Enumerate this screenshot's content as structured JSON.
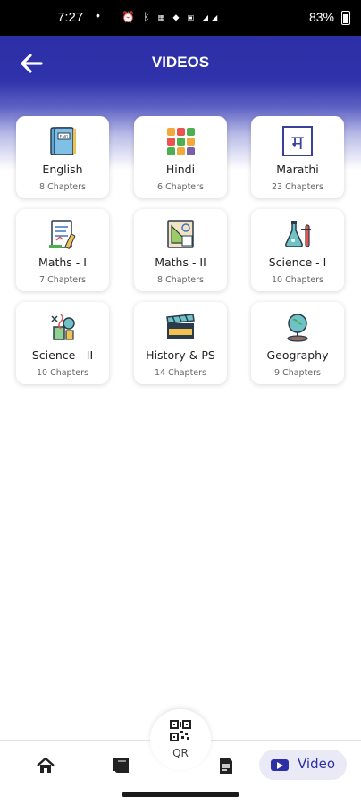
{
  "status_bar": {
    "time": "7:27",
    "dot": "•",
    "icons": "⏰ ᛒ ▦ ◆ ▣ ◢◢",
    "battery": "83%"
  },
  "header": {
    "title": "VIDEOS",
    "back_icon": "arrow-left-icon"
  },
  "subjects": [
    {
      "name": "English",
      "chapters": "8 Chapters",
      "icon": "english-book-icon"
    },
    {
      "name": "Hindi",
      "chapters": "6 Chapters",
      "icon": "hindi-letters-icon"
    },
    {
      "name": "Marathi",
      "chapters": "23 Chapters",
      "icon": "marathi-letter-icon",
      "glyph": "म"
    },
    {
      "name": "Maths - I",
      "chapters": "7 Chapters",
      "icon": "maths-notebook-icon"
    },
    {
      "name": "Maths - II",
      "chapters": "8 Chapters",
      "icon": "geometry-icon"
    },
    {
      "name": "Science - I",
      "chapters": "10 Chapters",
      "icon": "lab-flask-icon"
    },
    {
      "name": "Science - II",
      "chapters": "10 Chapters",
      "icon": "biology-icon"
    },
    {
      "name": "History & PS",
      "chapters": "14 Chapters",
      "icon": "history-clapper-icon"
    },
    {
      "name": "Geography",
      "chapters": "9 Chapters",
      "icon": "globe-icon"
    }
  ],
  "bottom_nav": {
    "qr_label": "QR",
    "video_label": "Video",
    "items": [
      "home-icon",
      "book-icon",
      "document-icon",
      "video-play-icon"
    ]
  },
  "colors": {
    "primary": "#2c2fa6",
    "pill_bg": "#e9eaf6"
  }
}
